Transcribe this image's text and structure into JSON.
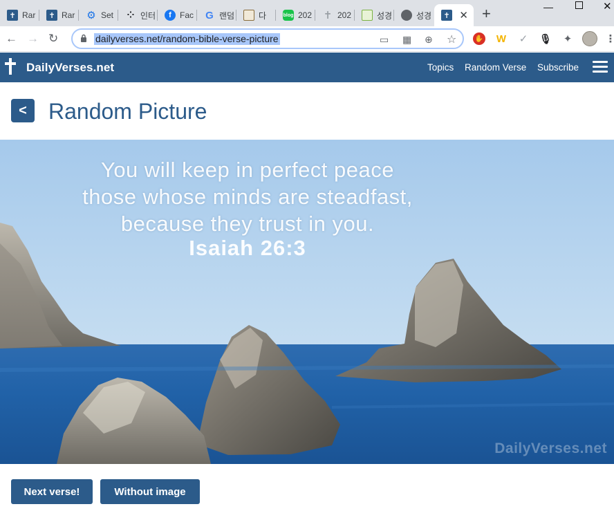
{
  "browser": {
    "tabs": [
      {
        "label": "Rar",
        "icon": "cross-icon",
        "color": "#2c5b8a"
      },
      {
        "label": "Rar",
        "icon": "cross-icon",
        "color": "#2c5b8a"
      },
      {
        "label": "Set",
        "icon": "gear-icon",
        "color": "#1a73e8"
      },
      {
        "label": "인터",
        "icon": "dots-icon",
        "color": "#202124"
      },
      {
        "label": "Fac",
        "icon": "facebook-icon",
        "color": "#1877f2"
      },
      {
        "label": "랜덤",
        "icon": "google-icon",
        "color": "#4285f4"
      },
      {
        "label": "다",
        "icon": "book-icon",
        "color": "#8a6d3b"
      },
      {
        "label": "202",
        "icon": "blog-icon",
        "color": "#19c34a"
      },
      {
        "label": "202",
        "icon": "cross-icon",
        "color": "#9aa0a6"
      },
      {
        "label": "성경",
        "icon": "book-icon",
        "color": "#7cb342"
      },
      {
        "label": "성경",
        "icon": "globe-icon",
        "color": "#5f6368"
      }
    ],
    "active_tab_icon": "cross-icon",
    "url": "dailyverses.net/random-bible-verse-picture"
  },
  "site": {
    "brand": "DailyVerses.net",
    "nav": {
      "topics": "Topics",
      "random_verse": "Random Verse",
      "subscribe": "Subscribe"
    },
    "back_label": "<",
    "title": "Random Picture",
    "verse_lines": [
      "You will keep in perfect peace",
      "those whose minds are steadfast,",
      "because they trust in you."
    ],
    "reference": "Isaiah 26:3",
    "watermark": "DailyVerses.net",
    "buttons": {
      "next": "Next verse!",
      "without_image": "Without image"
    }
  },
  "colors": {
    "brand": "#2c5b8a",
    "tabstrip": "#dee1e6",
    "url_highlight": "#a8c7fa"
  }
}
